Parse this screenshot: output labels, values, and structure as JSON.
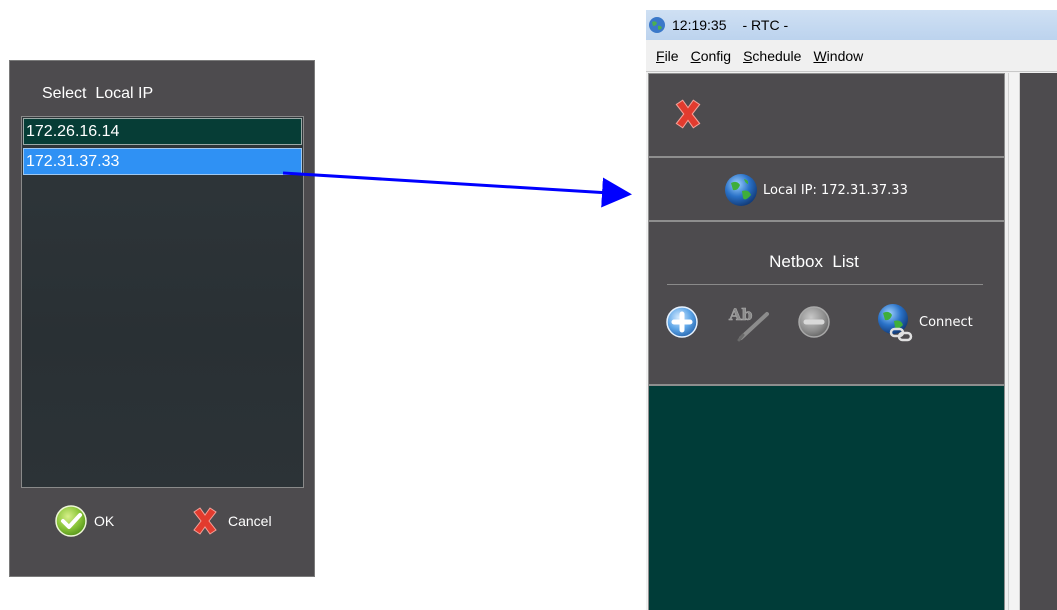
{
  "dialog": {
    "title": "Select  Local IP",
    "ips": [
      "172.26.16.14",
      "172.31.37.33"
    ],
    "selected_index": 1,
    "ok_label": "OK",
    "cancel_label": "Cancel"
  },
  "app": {
    "time": "12:19:35",
    "title": "- RTC -",
    "menu": [
      {
        "first": "F",
        "rest": "ile"
      },
      {
        "first": "C",
        "rest": "onfig"
      },
      {
        "first": "S",
        "rest": "chedule"
      },
      {
        "first": "W",
        "rest": "indow"
      }
    ],
    "local_ip": "Local IP: 172.31.37.33",
    "netbox_title": "Netbox  List",
    "connect_label": "Connect"
  },
  "colors": {
    "panel": "#4d4b4e",
    "list_bg": "#003c38",
    "selected_row": "#2f91f4",
    "arrow": "#0000ff"
  }
}
